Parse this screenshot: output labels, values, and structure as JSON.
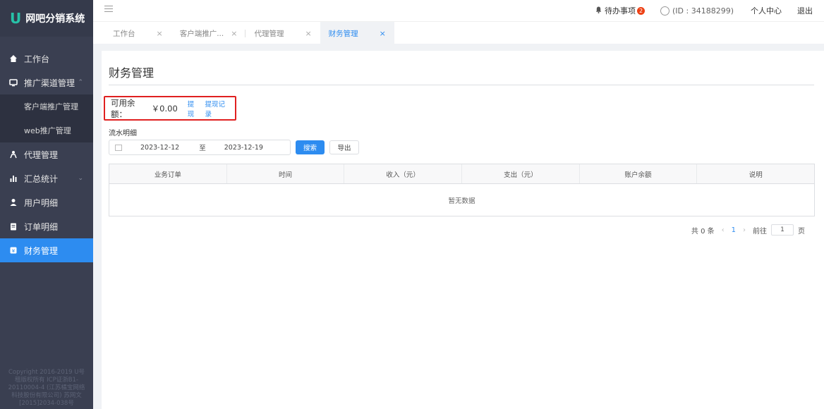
{
  "app": {
    "logo_mark": "U",
    "title": "网吧分销系统"
  },
  "sidebar": {
    "items": [
      {
        "label": "工作台",
        "icon": "home-icon"
      },
      {
        "label": "推广渠道管理",
        "icon": "monitor-icon",
        "expanded": true,
        "children": [
          {
            "label": "客户端推广管理"
          },
          {
            "label": "web推广管理"
          }
        ]
      },
      {
        "label": "代理管理",
        "icon": "agents-icon"
      },
      {
        "label": "汇总统计",
        "icon": "bar-chart-icon",
        "expanded": false
      },
      {
        "label": "用户明细",
        "icon": "user-icon"
      },
      {
        "label": "订单明细",
        "icon": "clipboard-icon"
      },
      {
        "label": "财务管理",
        "icon": "wallet-icon",
        "active": true
      }
    ],
    "copyright": "Copyright 2016-2019 U号租版权所有 ICP证浙B1-20110004-4 (江苏橘宝网络科技股份有限公司) 苏网文[2015]2034-038号"
  },
  "header": {
    "todo_label": "待办事项",
    "todo_count": "2",
    "user_id_text": "(ID : 34188299)",
    "personal_center": "个人中心",
    "logout": "退出"
  },
  "tabs": [
    {
      "label": "工作台",
      "active": false
    },
    {
      "label": "客户端推广...",
      "active": false
    },
    {
      "label": "代理管理",
      "active": false
    },
    {
      "label": "财务管理",
      "active": true
    }
  ],
  "tab_close_glyph": "×",
  "main": {
    "page_title": "财务管理",
    "balance_label": "可用余额：",
    "balance_value": "￥0.00",
    "withdraw_link": "提现",
    "withdraw_records_link": "提现记录",
    "flow_label": "流水明细",
    "date_start": "2023-12-12",
    "date_sep": "至",
    "date_end": "2023-12-19",
    "search_button": "搜索",
    "export_button": "导出",
    "table": {
      "columns": [
        "业务订单",
        "时间",
        "收入（元）",
        "支出（元）",
        "账户余额",
        "说明"
      ],
      "empty_text": "暂无数据"
    },
    "pager": {
      "total_text": "共 0 条",
      "prev": "‹",
      "current_page": "1",
      "next": "›",
      "goto_label": "前往",
      "goto_value": "1",
      "page_suffix": "页"
    }
  },
  "colors": {
    "sidebar_bg": "#3a3f51",
    "active_blue": "#2d8cf0",
    "highlight_red": "#e02020",
    "logo_green": "#27c2a8"
  }
}
